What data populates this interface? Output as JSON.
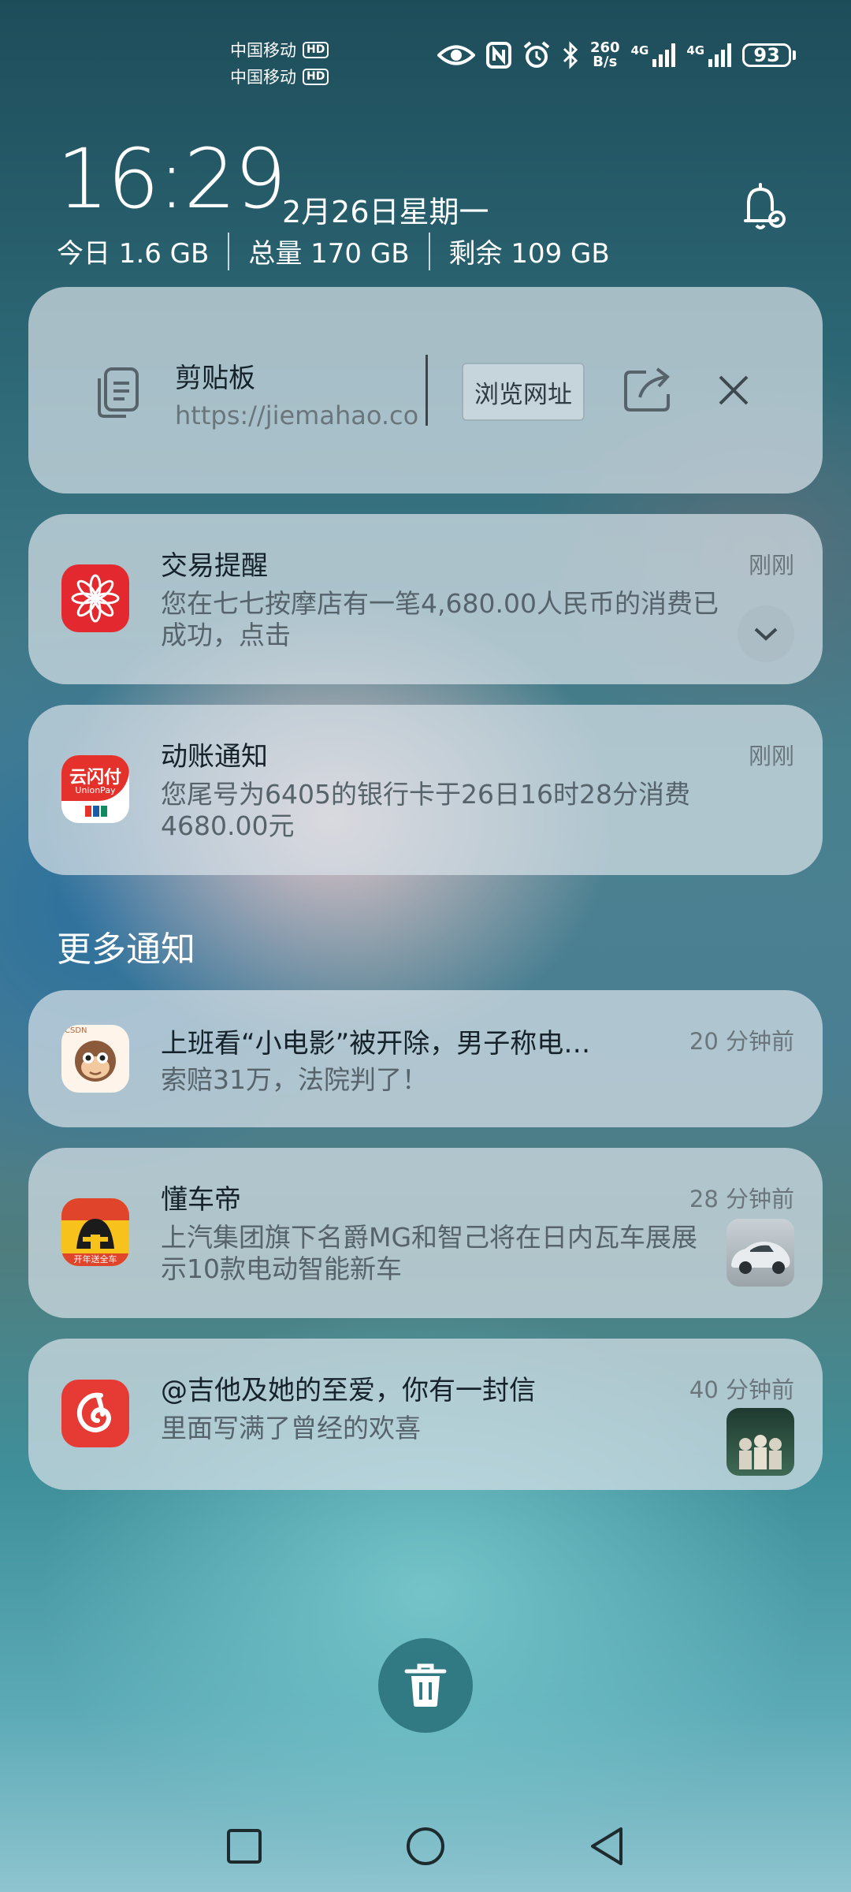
{
  "status_bar": {
    "carrier1": "中国移动",
    "carrier2": "中国移动",
    "hd": "HD",
    "net_speed_value": "260",
    "net_speed_unit": "B/s",
    "sig1_label": "4G",
    "sig2_label": "4G",
    "battery": "93",
    "icons": [
      "eye-icon",
      "nfc-icon",
      "alarm-icon",
      "bluetooth-icon"
    ]
  },
  "header": {
    "time": "16:29",
    "date": "2月26日星期一",
    "today_usage": "今日 1.6 GB",
    "total": "总量 170 GB",
    "remaining": "剩余 109 GB"
  },
  "clipboard": {
    "title": "剪贴板",
    "url": "https://jiemahao.co．.",
    "browse_label": "浏览网址"
  },
  "notifications": [
    {
      "title": "交易提醒",
      "body": "您在七七按摩店有一笔4,680.00人民币的消费已成功，点击",
      "time": "刚刚"
    },
    {
      "title": "动账通知",
      "body": "您尾号为6405的银行卡于26日16时28分消费4680.00元",
      "time": "刚刚",
      "icon_text": "云闪付",
      "icon_subtext": "UnionPay"
    }
  ],
  "more_section_title": "更多通知",
  "more_notifications": [
    {
      "title": "上班看“小电影”被开除，男子称电…",
      "body": "索赔31万，法院判了！",
      "time": "20 分钟前",
      "icon_badge": "CSDN"
    },
    {
      "title": "懂车帝",
      "body": "上汽集团旗下名爵MG和智己将在日内瓦车展展示10款电动智能新车",
      "time": "28 分钟前",
      "icon_badge": "开年送全车"
    },
    {
      "title": "@吉他及她的至爱，你有一封信",
      "body": "里面写满了曾经的欢喜",
      "time": "40 分钟前"
    }
  ],
  "colors": {
    "card_bg": "#d7e1e8",
    "bank_red": "#e3282f",
    "unionpay_red": "#e5312b",
    "netease_red": "#e63a35",
    "dongchedi_yellow": "#f6c21b",
    "trash_bg": "#2f7a86"
  }
}
